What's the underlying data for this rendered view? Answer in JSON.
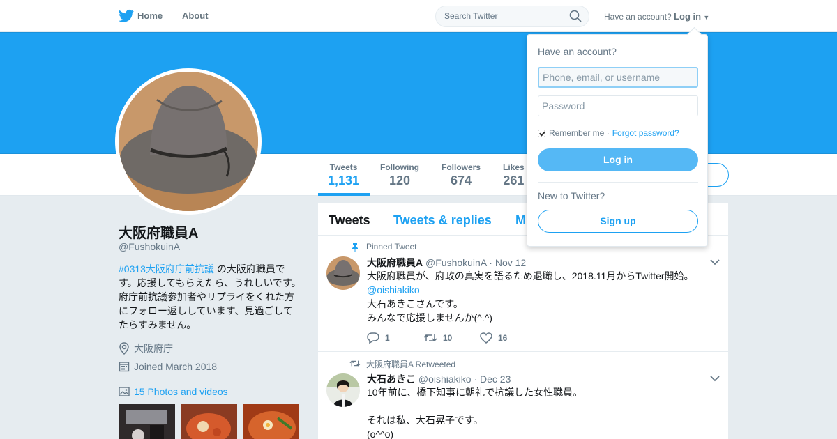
{
  "nav": {
    "home": "Home",
    "about": "About",
    "search_placeholder": "Search Twitter",
    "have_account": "Have an account?",
    "login": "Log in"
  },
  "profile": {
    "name": "大阪府職員A",
    "handle": "@FushokuinA",
    "bio_hashtag": "#0313大阪府庁前抗議",
    "bio_text": " の大阪府職員です。応援してもらえたら、うれしいです。府庁前抗議参加者やリプライをくれた方にフォロー返ししています、見過ごしてたらすみません。",
    "location": "大阪府庁",
    "joined": "Joined March 2018",
    "photos": "15 Photos and videos"
  },
  "stats": [
    {
      "label": "Tweets",
      "value": "1,131"
    },
    {
      "label": "Following",
      "value": "120"
    },
    {
      "label": "Followers",
      "value": "674"
    },
    {
      "label": "Likes",
      "value": "261"
    }
  ],
  "tabs": [
    "Tweets",
    "Tweets & replies",
    "M"
  ],
  "tweets": [
    {
      "context": "Pinned Tweet",
      "name": "大阪府職員A",
      "handle": "@FushokuinA",
      "date": "· Nov 12",
      "line1": "大阪府職員が、府政の真実を語るため退職し、2018.11月からTwitter開始。",
      "mention": "@oishiakiko",
      "line2": "大石あきこさんです。",
      "line3": "みんなで応援しませんか(^.^)",
      "replies": "1",
      "retweets": "10",
      "likes": "16"
    },
    {
      "context": "大阪府職員A Retweeted",
      "name": "大石あきこ",
      "handle": "@oishiakiko",
      "date": "· Dec 23",
      "line1": "10年前に、橋下知事に朝礼で抗議した女性職員。",
      "line2": "それは私、大石晃子です。",
      "line3": "(o^^o)"
    }
  ],
  "login_dropdown": {
    "title": "Have an account?",
    "user_placeholder": "Phone, email, or username",
    "password_placeholder": "Password",
    "remember": "Remember me ·",
    "forgot": "Forgot password?",
    "login_button": "Log in",
    "new_to_twitter": "New to Twitter?",
    "signup_button": "Sign up"
  },
  "colors": {
    "brand": "#1da1f2",
    "background": "#e6ecf0"
  }
}
